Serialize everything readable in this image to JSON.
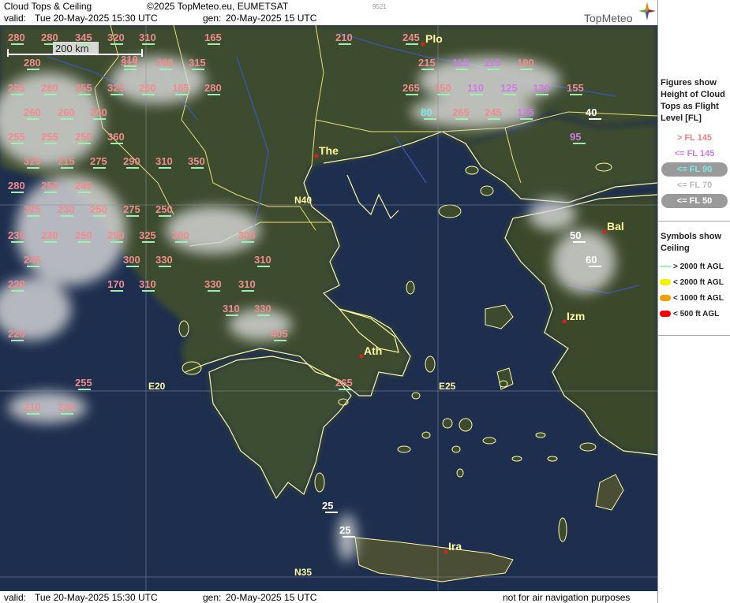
{
  "header": {
    "title": "Cloud Tops & Ceiling",
    "copyright": "©2025 TopMeteo.eu, EUMETSAT",
    "id_code": "9521",
    "valid_label": "valid:",
    "valid_value": "Tue  20-May-2025  15:30 UTC",
    "gen_label": "gen:",
    "gen_value": "20-May-2025 15 UTC",
    "brand": "TopMeteo"
  },
  "footer": {
    "valid_label": "valid:",
    "valid_value": "Tue  20-May-2025  15:30 UTC",
    "gen_label": "gen:",
    "gen_value": "20-May-2025 15 UTC",
    "disclaimer": "not for air navigation purposes"
  },
  "map": {
    "scale_label": "200 km",
    "grid_labels": [
      "N40",
      "E20",
      "E25",
      "N35"
    ],
    "cities": [
      "Plo",
      "The",
      "Bal",
      "Izm",
      "Ath",
      "Ira"
    ]
  },
  "legend": {
    "figures_title": "Figures show Height of Cloud Tops as Flight Level  [FL]",
    "levels": [
      {
        "label": "> FL 145",
        "color": "#f08080"
      },
      {
        "label": "<= FL 145",
        "color": "#d07ae8"
      },
      {
        "label": "<= FL 90",
        "color": "#7fe8e8"
      },
      {
        "label": "<= FL 70",
        "color": "#bbbbbb"
      },
      {
        "label": "<= FL 50",
        "color": "#ffffff"
      }
    ],
    "symbols_title": "Symbols show Ceiling",
    "symbols": [
      {
        "label": "> 2000 ft AGL",
        "color": "#9cf0b0"
      },
      {
        "label": "< 2000 ft AGL",
        "color": "#f5f000"
      },
      {
        "label": "< 1000 ft AGL",
        "color": "#f0a000"
      },
      {
        "label": "< 500 ft AGL",
        "color": "#f00000"
      }
    ]
  },
  "cloud_tops": [
    {
      "v": "280",
      "c": "pink"
    },
    {
      "v": "280",
      "c": "pink"
    },
    {
      "v": "345",
      "c": "pink"
    },
    {
      "v": "320",
      "c": "pink"
    },
    {
      "v": "310",
      "c": "pink"
    },
    {
      "v": "165",
      "c": "pink"
    },
    {
      "v": "210",
      "c": "pink"
    },
    {
      "v": "245",
      "c": "pink"
    },
    {
      "v": "280",
      "c": "pink"
    },
    {
      "v": "315",
      "c": "pink"
    },
    {
      "v": "280",
      "c": "pink"
    },
    {
      "v": "315",
      "c": "pink"
    },
    {
      "v": "310",
      "c": "pink"
    },
    {
      "v": "215",
      "c": "pink"
    },
    {
      "v": "115",
      "c": "violet"
    },
    {
      "v": "115",
      "c": "violet"
    },
    {
      "v": "190",
      "c": "pink"
    },
    {
      "v": "255",
      "c": "pink"
    },
    {
      "v": "280",
      "c": "pink"
    },
    {
      "v": "255",
      "c": "pink"
    },
    {
      "v": "325",
      "c": "pink"
    },
    {
      "v": "260",
      "c": "pink"
    },
    {
      "v": "185",
      "c": "pink"
    },
    {
      "v": "280",
      "c": "pink"
    },
    {
      "v": "265",
      "c": "pink"
    },
    {
      "v": "150",
      "c": "pink"
    },
    {
      "v": "110",
      "c": "violet"
    },
    {
      "v": "125",
      "c": "violet"
    },
    {
      "v": "130",
      "c": "violet"
    },
    {
      "v": "155",
      "c": "pink"
    },
    {
      "v": "260",
      "c": "pink"
    },
    {
      "v": "260",
      "c": "pink"
    },
    {
      "v": "260",
      "c": "pink"
    },
    {
      "v": "80",
      "c": "cyan"
    },
    {
      "v": "265",
      "c": "pink"
    },
    {
      "v": "245",
      "c": "pink"
    },
    {
      "v": "125",
      "c": "violet"
    },
    {
      "v": "40",
      "c": "white"
    },
    {
      "v": "255",
      "c": "pink"
    },
    {
      "v": "255",
      "c": "pink"
    },
    {
      "v": "250",
      "c": "pink"
    },
    {
      "v": "360",
      "c": "pink"
    },
    {
      "v": "95",
      "c": "violet"
    },
    {
      "v": "325",
      "c": "pink"
    },
    {
      "v": "215",
      "c": "pink"
    },
    {
      "v": "275",
      "c": "pink"
    },
    {
      "v": "290",
      "c": "pink"
    },
    {
      "v": "310",
      "c": "pink"
    },
    {
      "v": "350",
      "c": "pink"
    },
    {
      "v": "280",
      "c": "pink"
    },
    {
      "v": "250",
      "c": "pink"
    },
    {
      "v": "245",
      "c": "pink"
    },
    {
      "v": "325",
      "c": "pink"
    },
    {
      "v": "230",
      "c": "pink"
    },
    {
      "v": "250",
      "c": "pink"
    },
    {
      "v": "275",
      "c": "pink"
    },
    {
      "v": "250",
      "c": "pink"
    },
    {
      "v": "230",
      "c": "pink"
    },
    {
      "v": "230",
      "c": "pink"
    },
    {
      "v": "250",
      "c": "pink"
    },
    {
      "v": "290",
      "c": "pink"
    },
    {
      "v": "325",
      "c": "pink"
    },
    {
      "v": "300",
      "c": "pink"
    },
    {
      "v": "305",
      "c": "pink"
    },
    {
      "v": "50",
      "c": "white"
    },
    {
      "v": "245",
      "c": "pink"
    },
    {
      "v": "300",
      "c": "pink"
    },
    {
      "v": "330",
      "c": "pink"
    },
    {
      "v": "310",
      "c": "pink"
    },
    {
      "v": "60",
      "c": "white"
    },
    {
      "v": "220",
      "c": "pink"
    },
    {
      "v": "170",
      "c": "pink"
    },
    {
      "v": "310",
      "c": "pink"
    },
    {
      "v": "330",
      "c": "pink"
    },
    {
      "v": "310",
      "c": "pink"
    },
    {
      "v": "310",
      "c": "pink"
    },
    {
      "v": "330",
      "c": "pink"
    },
    {
      "v": "220",
      "c": "pink"
    },
    {
      "v": "405",
      "c": "pink"
    },
    {
      "v": "265",
      "c": "pink"
    },
    {
      "v": "255",
      "c": "pink"
    },
    {
      "v": "210",
      "c": "pink"
    },
    {
      "v": "230",
      "c": "pink"
    },
    {
      "v": "25",
      "c": "white"
    },
    {
      "v": "25",
      "c": "white"
    }
  ]
}
